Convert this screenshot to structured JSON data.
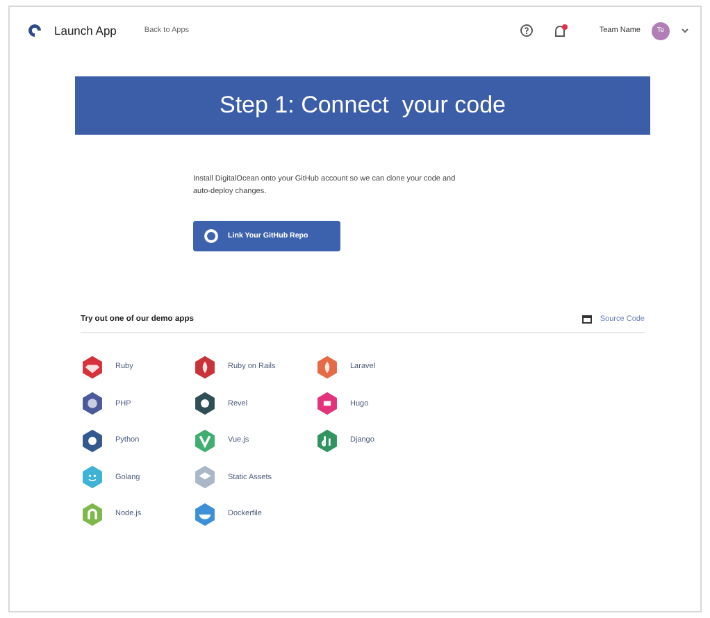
{
  "header": {
    "app_name": "Launch App",
    "back_link": "Back to Apps",
    "team_name": "Team Name",
    "avatar_initials": "Te"
  },
  "banner": {
    "title": "Step 1: Connect  your code"
  },
  "intro": "Install DigitalOcean onto your GitHub account so we can clone your code and auto-deploy changes.",
  "github_button": "Link Your GitHub Repo",
  "demo_section": {
    "title": "Try out one of our demo apps",
    "source_link": "Source Code",
    "apps": [
      {
        "name": "Ruby",
        "color": "#d8313a",
        "kind": "gem"
      },
      {
        "name": "PHP",
        "color": "#4a5a9a",
        "kind": "elephant"
      },
      {
        "name": "Python",
        "color": "#33598f",
        "kind": "dot"
      },
      {
        "name": "Golang",
        "color": "#3fb3d6",
        "kind": "face"
      },
      {
        "name": "Node.js",
        "color": "#7fb84a",
        "kind": "arch"
      },
      {
        "name": "Ruby on Rails",
        "color": "#c8333a",
        "kind": "drop"
      },
      {
        "name": "Revel",
        "color": "#2f4f55",
        "kind": "dot"
      },
      {
        "name": "Vue.js",
        "color": "#3fae6f",
        "kind": "v"
      },
      {
        "name": "Static Assets",
        "color": "#a9b7c6",
        "kind": "layers"
      },
      {
        "name": "Dockerfile",
        "color": "#3d8fd6",
        "kind": "whale"
      },
      {
        "name": "Laravel",
        "color": "#e56a45",
        "kind": "drop"
      },
      {
        "name": "Hugo",
        "color": "#e2347d",
        "kind": "square"
      },
      {
        "name": "Django",
        "color": "#2f9460",
        "kind": "dj"
      }
    ]
  }
}
